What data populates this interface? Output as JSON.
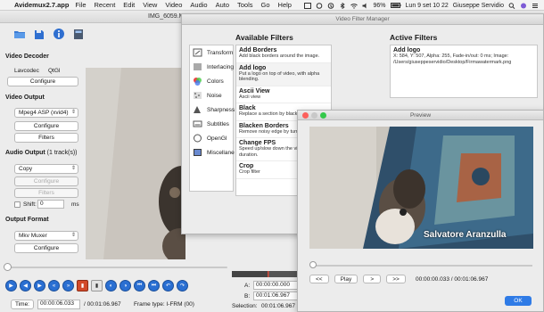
{
  "menubar": {
    "app_name": "Avidemux2.7.app",
    "items": [
      "File",
      "Recent",
      "Edit",
      "View",
      "Video",
      "Audio",
      "Auto",
      "Tools",
      "Go",
      "Help"
    ],
    "battery": "96%",
    "datetime": "Lun 9 set  10 22",
    "user": "Giuseppe Servidio"
  },
  "main": {
    "title": "IMG_6059.M",
    "video_decoder": {
      "title": "Video Decoder",
      "lavcodec": "Lavcodec",
      "qtgl": "QtGl",
      "configure": "Configure"
    },
    "video_output": {
      "title": "Video Output",
      "codec": "Mpeg4 ASP (xvid4)",
      "configure": "Configure",
      "filters": "Filters"
    },
    "audio_output": {
      "title": "Audio Output",
      "tracks": "(1 track(s))",
      "codec": "Copy",
      "configure": "Configure",
      "filters": "Filters",
      "shift_label": "Shift:",
      "shift_value": "0",
      "shift_unit": "ms"
    },
    "output_format": {
      "title": "Output Format",
      "muxer": "Mkv Muxer",
      "configure": "Configure"
    },
    "status": {
      "time_label": "Time:",
      "time_value": "00:00:06.033",
      "total": "/ 00:01:06.967",
      "frame_type": "Frame type:  I-FRM (00)"
    },
    "selection": {
      "a_label": "A:",
      "a_value": "00:00:00.000",
      "b_label": "B:",
      "b_value": "00:01:06.967",
      "sel_label": "Selection:",
      "sel_value": "00:01:06.967"
    }
  },
  "vfm": {
    "title": "Video Filter Manager",
    "available_title": "Available Filters",
    "active_title": "Active Filters",
    "categories": [
      {
        "label": "Transform",
        "icon": "transform-icon"
      },
      {
        "label": "Interlacing",
        "icon": "interlacing-icon"
      },
      {
        "label": "Colors",
        "icon": "colors-icon"
      },
      {
        "label": "Noise",
        "icon": "noise-icon"
      },
      {
        "label": "Sharpness",
        "icon": "sharpness-icon"
      },
      {
        "label": "Subtitles",
        "icon": "subtitles-icon"
      },
      {
        "label": "OpenGl",
        "icon": "opengl-icon"
      },
      {
        "label": "Miscellane",
        "icon": "misc-icon"
      }
    ],
    "available": [
      {
        "name": "Add Borders",
        "desc": "Add black borders around the image."
      },
      {
        "name": "Add logo",
        "desc": "Put a logo on top of video, with alpha blending."
      },
      {
        "name": "Ascii View",
        "desc": "Ascii view"
      },
      {
        "name": "Black",
        "desc": "Replace a section by black"
      },
      {
        "name": "Blacken Borders",
        "desc": "Remove noisy edge by turn"
      },
      {
        "name": "Change FPS",
        "desc": "Speed up/slow down the vi changes duration."
      },
      {
        "name": "Crop",
        "desc": "Crop filter"
      }
    ],
    "active": [
      {
        "name": "Add logo",
        "desc": "X: 584, Y: 507, Alpha: 255, Fade-in/out: 0 ms; Image: /Users/giuseppeservidio/Desktop/Firmawatermark.png"
      }
    ]
  },
  "preview": {
    "title": "Preview",
    "watermark": "Salvatore Aranzulla",
    "buttons": [
      "<<",
      "Play",
      ">",
      ">>"
    ],
    "time": "00:00:00.033 / 00:01:06.967",
    "ok": "OK"
  },
  "colors": {
    "accent": "#2f7be6",
    "nav_blue": "#2a6fd2"
  }
}
